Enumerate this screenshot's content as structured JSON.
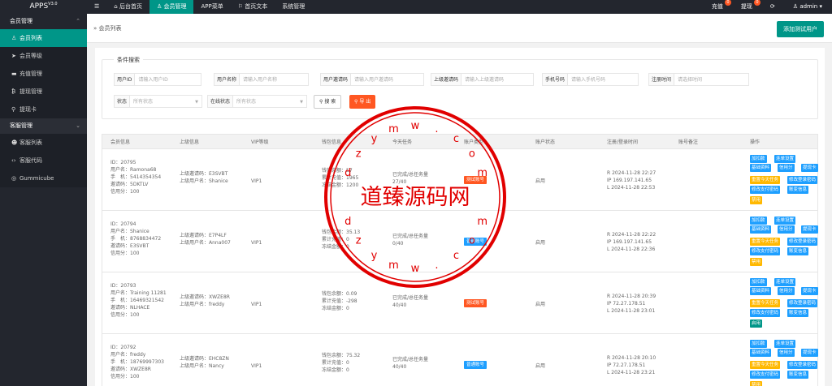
{
  "brand": {
    "name": "APPS",
    "version": "V3.0"
  },
  "topnav": [
    {
      "icon": "menu-icon",
      "label": "☰"
    },
    {
      "label": "后台首页"
    },
    {
      "label": "会员管理",
      "active": true
    },
    {
      "label": "APP菜单"
    },
    {
      "label": "首页文本"
    },
    {
      "label": "系统管理"
    }
  ],
  "topright": {
    "recharge": "充值",
    "recharge_badge": "0",
    "withdraw": "提现",
    "withdraw_badge": "0",
    "user": "admin"
  },
  "sidebar": {
    "group1": "会员管理",
    "items1": [
      "会员列表",
      "会员等级",
      "充值管理",
      "提现管理",
      "提现卡"
    ],
    "group2": "客服管理",
    "items2": [
      "客服列表",
      "客服代码",
      "Gummicube"
    ]
  },
  "breadcrumb": "会员列表",
  "add_button": "添加测试用户",
  "filters": {
    "legend": "条件搜索",
    "user_id": {
      "label": "用户ID",
      "placeholder": "请输入用户ID"
    },
    "username": {
      "label": "用户名称",
      "placeholder": "请输入用户名称"
    },
    "invite_code": {
      "label": "用户邀请码",
      "placeholder": "请输入用户邀请码"
    },
    "parent_code": {
      "label": "上级邀请码",
      "placeholder": "请输入上级邀请码"
    },
    "phone": {
      "label": "手机号码",
      "placeholder": "请输入手机号码"
    },
    "reg_time": {
      "label": "注册时间",
      "placeholder": "请选择时间"
    },
    "status": {
      "label": "状态",
      "placeholder": "所有状态"
    },
    "online": {
      "label": "在线状态",
      "placeholder": "所有状态"
    },
    "search_btn": "搜 索",
    "export_btn": "导 出"
  },
  "columns": [
    "会员信息",
    "上级信息",
    "VIP等级",
    "钱包信息",
    "今天任务",
    "账户类型",
    "账户状态",
    "注册/登录时间",
    "账号备注",
    "操作"
  ],
  "rows": [
    {
      "id": "ID：20795",
      "name": "用户名：Ramona68",
      "phone": "手　机：5414354354",
      "code": "邀请码：5DKTLV",
      "credit": "信用分：100",
      "parent_code": "上级邀请码：E3SVBT",
      "parent_name": "上级用户名：Shanice",
      "vip": "VIP1",
      "wallet": "钱包余额：57",
      "recharge": "累计充值：1965",
      "frozen": "冻结金额：1200",
      "task": "已完成/总任务量",
      "task_val": "27/40",
      "type": "测试账号",
      "type_kind": "test",
      "state": "启用",
      "reg": "R 2024-11-28 22:27",
      "ip": "IP 169.197.141.65",
      "login": "L 2024-11-28 22:53",
      "ops": [
        "加扣款",
        "连单设置",
        "基础资料",
        "信用分",
        "提现卡",
        "重置今天任务",
        "修改登录密码",
        "修改支付密码",
        "账变信息",
        "禁用"
      ]
    },
    {
      "id": "ID：20794",
      "name": "用户名：Shanice",
      "phone": "手　机：8768834472",
      "code": "邀请码：E3SVBT",
      "credit": "信用分：100",
      "parent_code": "上级邀请码：E7P4LF",
      "parent_name": "上级用户名：Anna007",
      "vip": "VIP1",
      "wallet": "钱包余额：35.13",
      "recharge": "累计充值：0",
      "frozen": "冻结金额：0",
      "task": "已完成/总任务量",
      "task_val": "0/40",
      "type": "普通账号",
      "type_kind": "normal",
      "state": "启用",
      "reg": "R 2024-11-28 22:22",
      "ip": "IP 169.197.141.65",
      "login": "L 2024-11-28 22:36",
      "ops": [
        "加扣款",
        "连单设置",
        "基础资料",
        "信用分",
        "提现卡",
        "重置今天任务",
        "修改登录密码",
        "修改支付密码",
        "账变信息",
        "禁用"
      ]
    },
    {
      "id": "ID：20793",
      "name": "用户名：Training 11281",
      "phone": "手　机：16469321542",
      "code": "邀请码：NLHACE",
      "credit": "信用分：100",
      "parent_code": "上级邀请码：XWZE8R",
      "parent_name": "上级用户名：freddy",
      "vip": "VIP1",
      "wallet": "钱包余额：0.09",
      "recharge": "累计充值：-298",
      "frozen": "冻结金额：0",
      "task": "已完成/总任务量",
      "task_val": "40/40",
      "type": "测试账号",
      "type_kind": "test",
      "state": "启用",
      "reg": "R 2024-11-28 20:39",
      "ip": "IP 72.27.178.51",
      "login": "L 2024-11-28 23:01",
      "ops": [
        "加扣款",
        "连单设置",
        "基础资料",
        "信用分",
        "提现卡",
        "重置今天任务",
        "修改登录密码",
        "修改支付密码",
        "账变信息",
        "启用"
      ]
    },
    {
      "id": "ID：20792",
      "name": "用户名：freddy",
      "phone": "手　机：18769997303",
      "code": "邀请码：XWZE8R",
      "credit": "信用分：100",
      "parent_code": "上级邀请码：EHC8ZN",
      "parent_name": "上级用户名：Nancy",
      "vip": "VIP1",
      "wallet": "钱包余额：75.32",
      "recharge": "累计充值：0",
      "frozen": "冻结金额：0",
      "task": "已完成/总任务量",
      "task_val": "40/40",
      "type": "普通账号",
      "type_kind": "normal",
      "state": "启用",
      "reg": "R 2024-11-28 20:10",
      "ip": "IP 72.27.178.51",
      "login": "L 2024-11-28 23:21",
      "ops": [
        "加扣款",
        "连单设置",
        "基础资料",
        "信用分",
        "提现卡",
        "重置今天任务",
        "修改登录密码",
        "修改支付密码",
        "账变信息",
        "禁用"
      ]
    }
  ],
  "watermark": {
    "text": "道臻源码网",
    "ring": "dzymw.com"
  }
}
